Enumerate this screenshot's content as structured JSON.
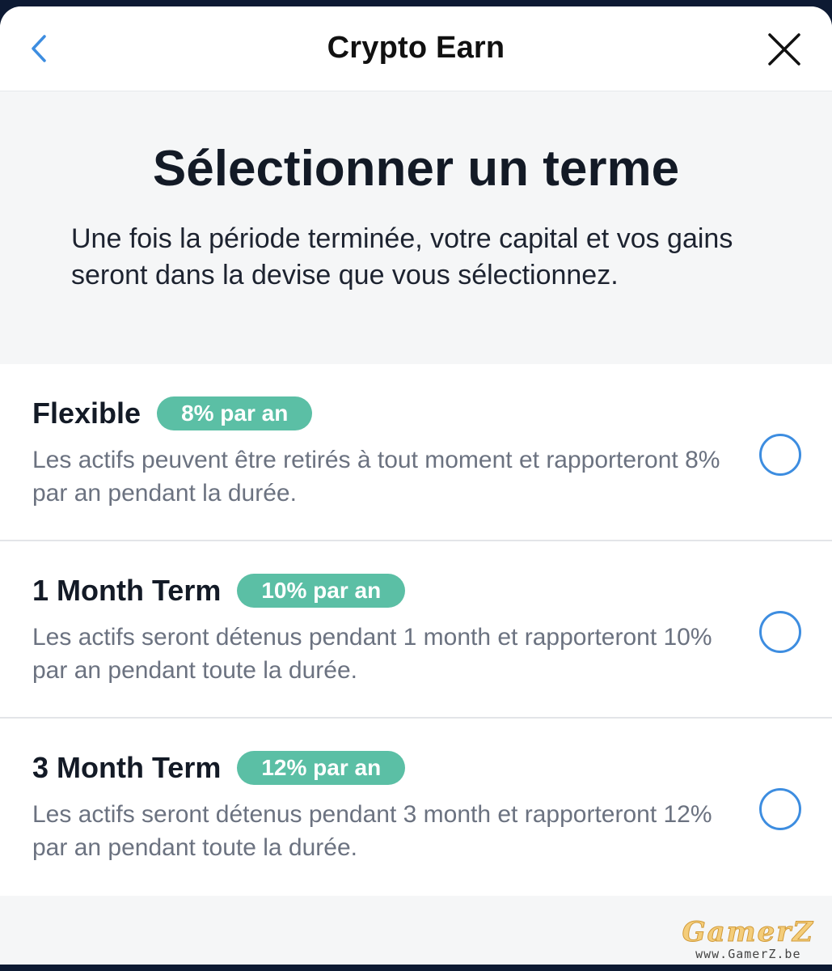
{
  "header": {
    "title": "Crypto Earn",
    "back_icon": "chevron-left-icon",
    "close_icon": "close-icon"
  },
  "intro": {
    "title": "Sélectionner un terme",
    "text": "Une fois la période terminée, votre capital et vos gains seront dans la devise que vous sélectionnez."
  },
  "options": [
    {
      "name": "Flexible",
      "rate": "8% par an",
      "description": "Les actifs peuvent être retirés à tout moment et rapporteront 8% par an pendant la durée.",
      "selected": false
    },
    {
      "name": "1 Month Term",
      "rate": "10% par an",
      "description": "Les actifs seront détenus pendant 1 month et rapporteront 10% par an pendant toute la durée.",
      "selected": false
    },
    {
      "name": "3 Month Term",
      "rate": "12% par an",
      "description": "Les actifs seront détenus pendant 3 month et rapporteront 12% par an pendant toute la durée.",
      "selected": false
    }
  ],
  "watermark": {
    "logo": "GamerZ",
    "url": "www.GamerZ.be"
  },
  "colors": {
    "accent": "#3d8de0",
    "badge": "#5bbfa5",
    "text_dark": "#131a26",
    "text_muted": "#6b7280",
    "background": "#f5f6f7"
  }
}
